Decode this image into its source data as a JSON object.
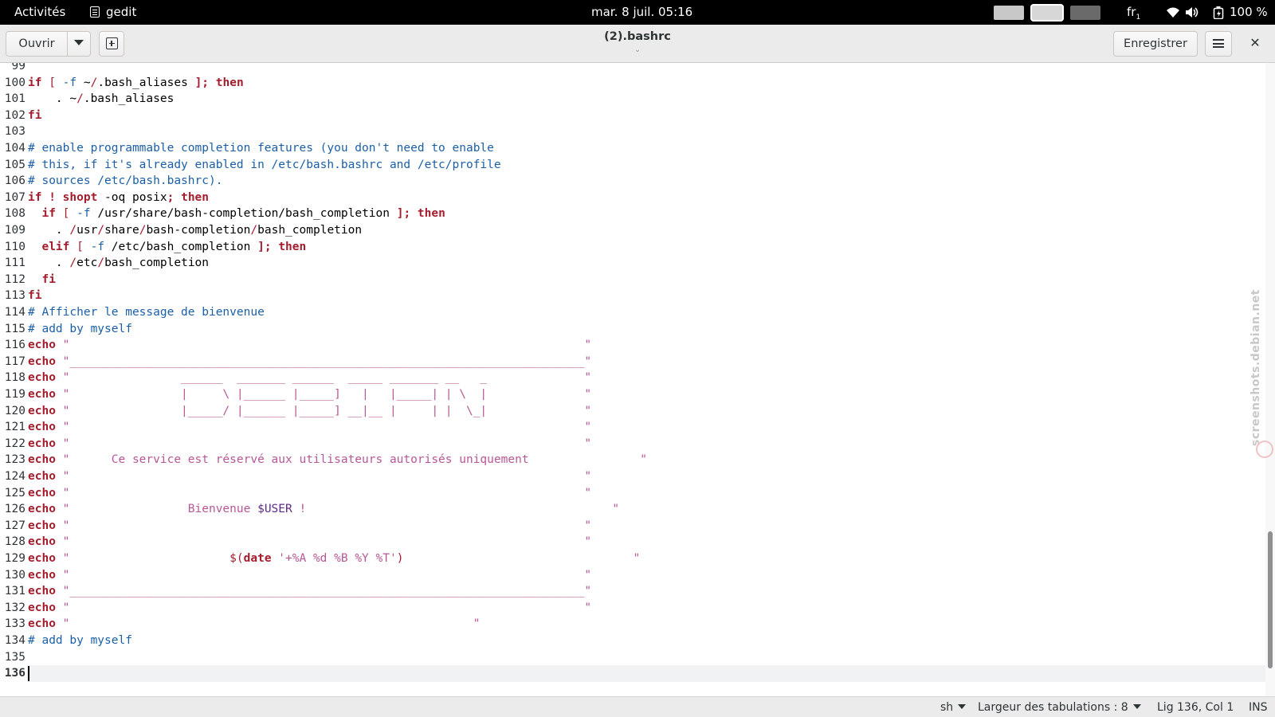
{
  "topbar": {
    "activities": "Activités",
    "app_name": "gedit",
    "clock": "mar. 8 juil.  05:16",
    "keyboard_layout": "fr",
    "keyboard_layout_sub": "1",
    "battery_pct": "100 %",
    "icons": [
      "wifi-icon",
      "volume-icon",
      "battery-icon"
    ]
  },
  "header": {
    "open_label": "Ouvrir",
    "title": "(2).bashrc",
    "title_caret": "⌄",
    "save_label": "Enregistrer",
    "close_glyph": "✕"
  },
  "editor": {
    "current_line": 136,
    "lines": [
      {
        "n": "99",
        "segs": []
      },
      {
        "n": "100",
        "segs": [
          [
            "if",
            "kw"
          ],
          [
            " [ ",
            "op"
          ],
          [
            "-f",
            "cm"
          ],
          [
            " ~",
            "p"
          ],
          [
            "/",
            "op"
          ],
          [
            ".bash_aliases ",
            "p"
          ],
          [
            "]; then",
            "kw"
          ]
        ]
      },
      {
        "n": "101",
        "segs": [
          [
            "    . ~",
            "p"
          ],
          [
            "/",
            "op"
          ],
          [
            ".bash_aliases",
            "p"
          ]
        ]
      },
      {
        "n": "102",
        "segs": [
          [
            "fi",
            "kw"
          ]
        ]
      },
      {
        "n": "103",
        "segs": []
      },
      {
        "n": "104",
        "segs": [
          [
            "# enable programmable completion features (you don't need to enable",
            "cm"
          ]
        ]
      },
      {
        "n": "105",
        "segs": [
          [
            "# this, if it's already enabled in /etc/bash.bashrc and /etc/profile",
            "cm"
          ]
        ]
      },
      {
        "n": "106",
        "segs": [
          [
            "# sources /etc/bash.bashrc).",
            "cm"
          ]
        ]
      },
      {
        "n": "107",
        "segs": [
          [
            "if",
            "kw"
          ],
          [
            " ",
            "p"
          ],
          [
            "!",
            "kw"
          ],
          [
            " ",
            "p"
          ],
          [
            "shopt",
            "kw"
          ],
          [
            " -oq posix",
            "p"
          ],
          [
            "; then",
            "kw"
          ]
        ]
      },
      {
        "n": "108",
        "segs": [
          [
            "  ",
            "p"
          ],
          [
            "if",
            "kw"
          ],
          [
            " [ ",
            "op"
          ],
          [
            "-f",
            "cm"
          ],
          [
            " /usr/share/bash-completion/bash_completion ",
            "p"
          ],
          [
            "]; then",
            "kw"
          ]
        ]
      },
      {
        "n": "109",
        "segs": [
          [
            "    . ",
            "p"
          ],
          [
            "/",
            "op"
          ],
          [
            "usr",
            "p"
          ],
          [
            "/",
            "op"
          ],
          [
            "share",
            "p"
          ],
          [
            "/",
            "op"
          ],
          [
            "bash-completion",
            "p"
          ],
          [
            "/",
            "op"
          ],
          [
            "bash_completion",
            "p"
          ]
        ]
      },
      {
        "n": "110",
        "segs": [
          [
            "  ",
            "p"
          ],
          [
            "elif",
            "kw"
          ],
          [
            " [ ",
            "op"
          ],
          [
            "-f",
            "cm"
          ],
          [
            " /etc/bash_completion ",
            "p"
          ],
          [
            "]; then",
            "kw"
          ]
        ]
      },
      {
        "n": "111",
        "segs": [
          [
            "    . ",
            "p"
          ],
          [
            "/",
            "op"
          ],
          [
            "etc",
            "p"
          ],
          [
            "/",
            "op"
          ],
          [
            "bash_completion",
            "p"
          ]
        ]
      },
      {
        "n": "112",
        "segs": [
          [
            "  ",
            "p"
          ],
          [
            "fi",
            "kw"
          ]
        ]
      },
      {
        "n": "113",
        "segs": [
          [
            "fi",
            "kw"
          ]
        ]
      },
      {
        "n": "114",
        "segs": [
          [
            "# Afficher le message de bienvenue",
            "cm"
          ]
        ]
      },
      {
        "n": "115",
        "segs": [
          [
            "# add by myself",
            "cm"
          ]
        ]
      },
      {
        "n": "116",
        "segs": [
          [
            "echo",
            "kw"
          ],
          [
            " \"                                                                          \"",
            "st"
          ]
        ]
      },
      {
        "n": "117",
        "segs": [
          [
            "echo",
            "kw"
          ],
          [
            " \"__________________________________________________________________________\"",
            "st"
          ]
        ]
      },
      {
        "n": "118",
        "segs": [
          [
            "echo",
            "kw"
          ],
          [
            " \"                ______  _______ ______  _____ _______ __   _              \"",
            "st"
          ]
        ]
      },
      {
        "n": "119",
        "segs": [
          [
            "echo",
            "kw"
          ],
          [
            " \"                |     \\ |______ |_____]   |   |_____| | \\  |              \"",
            "st"
          ]
        ]
      },
      {
        "n": "120",
        "segs": [
          [
            "echo",
            "kw"
          ],
          [
            " \"                |_____/ |______ |_____] __|__ |     | |  \\_|              \"",
            "st"
          ]
        ]
      },
      {
        "n": "121",
        "segs": [
          [
            "echo",
            "kw"
          ],
          [
            " \"                                                                          \"",
            "st"
          ]
        ]
      },
      {
        "n": "122",
        "segs": [
          [
            "echo",
            "kw"
          ],
          [
            " \"                                                                          \"",
            "st"
          ]
        ]
      },
      {
        "n": "123",
        "segs": [
          [
            "echo",
            "kw"
          ],
          [
            " \"      Ce service est réservé aux utilisateurs autorisés uniquement                \"",
            "st"
          ]
        ]
      },
      {
        "n": "124",
        "segs": [
          [
            "echo",
            "kw"
          ],
          [
            " \"                                                                          \"",
            "st"
          ]
        ]
      },
      {
        "n": "125",
        "segs": [
          [
            "echo",
            "kw"
          ],
          [
            " \"                                                                          \"",
            "st"
          ]
        ]
      },
      {
        "n": "126",
        "segs": [
          [
            "echo",
            "kw"
          ],
          [
            " \"                 Bienvenue ",
            "st"
          ],
          [
            "$USER",
            "vr"
          ],
          [
            " !                                            \"",
            "st"
          ]
        ]
      },
      {
        "n": "127",
        "segs": [
          [
            "echo",
            "kw"
          ],
          [
            " \"                                                                          \"",
            "st"
          ]
        ]
      },
      {
        "n": "128",
        "segs": [
          [
            "echo",
            "kw"
          ],
          [
            " \"                                                                          \"",
            "st"
          ]
        ]
      },
      {
        "n": "129",
        "segs": [
          [
            "echo",
            "kw"
          ],
          [
            " \"                       ",
            "st"
          ],
          [
            "$(",
            "op"
          ],
          [
            "date",
            "kw"
          ],
          [
            " '+%A %d %B %Y %T'",
            "st"
          ],
          [
            ")",
            "op"
          ],
          [
            "                                 \"",
            "st"
          ]
        ]
      },
      {
        "n": "130",
        "segs": [
          [
            "echo",
            "kw"
          ],
          [
            " \"                                                                          \"",
            "st"
          ]
        ]
      },
      {
        "n": "131",
        "segs": [
          [
            "echo",
            "kw"
          ],
          [
            " \"__________________________________________________________________________\"",
            "st"
          ]
        ]
      },
      {
        "n": "132",
        "segs": [
          [
            "echo",
            "kw"
          ],
          [
            " \"                                                                          \"",
            "st"
          ]
        ]
      },
      {
        "n": "133",
        "segs": [
          [
            "echo",
            "kw"
          ],
          [
            " \"                                                          \"",
            "st"
          ]
        ]
      },
      {
        "n": "134",
        "segs": [
          [
            "# add by myself",
            "cm"
          ]
        ]
      },
      {
        "n": "135",
        "segs": []
      },
      {
        "n": "136",
        "segs": []
      }
    ]
  },
  "scrollbar": {
    "position_fraction": 0.94,
    "visible_fraction": 0.27
  },
  "watermark": "screenshots.debian.net",
  "statusbar": {
    "language": "sh",
    "tab_width": "Largeur des tabulations : 8",
    "cursor_pos": "Lig 136, Col 1",
    "mode": "INS"
  },
  "colors": {
    "keyword": "#a51d2d",
    "comment": "#1c5fa6",
    "string": "#b75796",
    "variable": "#5d2a8a"
  }
}
